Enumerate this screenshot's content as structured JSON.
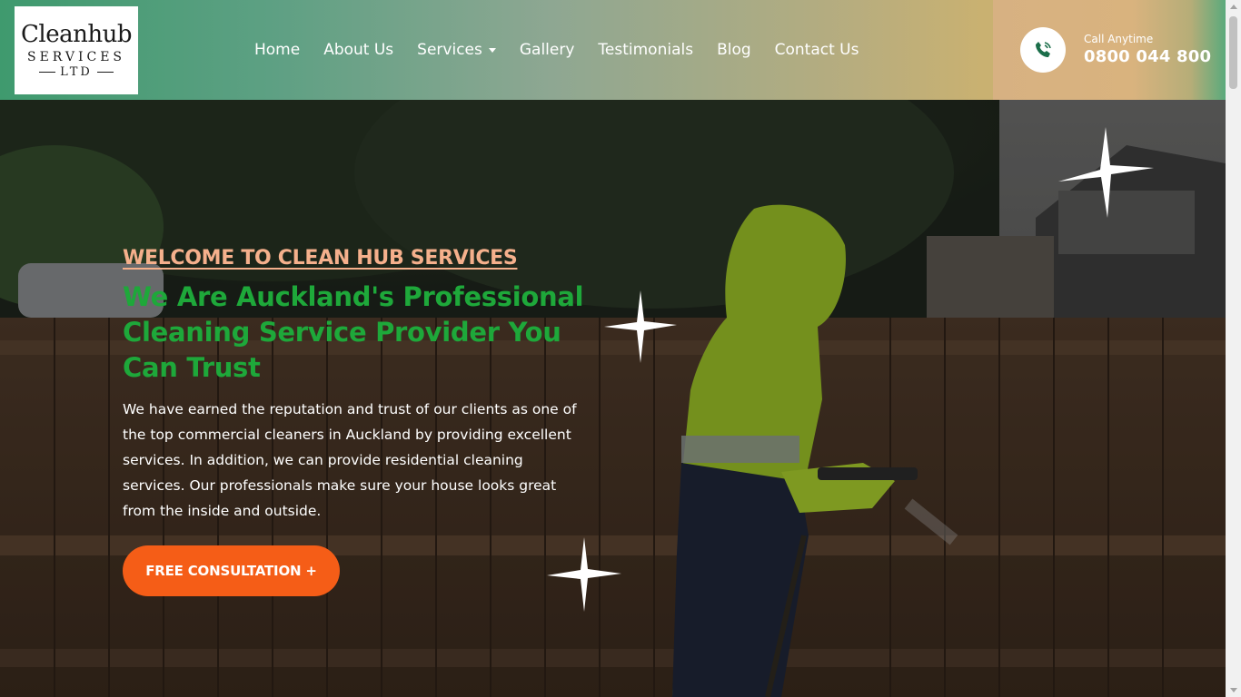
{
  "logo": {
    "line1": "Cleanhub",
    "line2": "SERVICES",
    "line3": "LTD"
  },
  "nav": {
    "items": [
      {
        "label": "Home"
      },
      {
        "label": "About Us"
      },
      {
        "label": "Services"
      },
      {
        "label": "Gallery"
      },
      {
        "label": "Testimonials"
      },
      {
        "label": "Blog"
      },
      {
        "label": "Contact Us"
      }
    ]
  },
  "call": {
    "label": "Call Anytime",
    "number": "0800 044 800",
    "icon": "phone-icon"
  },
  "hero": {
    "welcome": "WELCOME TO CLEAN HUB SERVICES",
    "headline": "We Are Auckland's Professional Cleaning Service Provider You Can Trust",
    "description": "We have earned the reputation and trust of our clients as one of the top commercial cleaners in Auckland by providing excellent services. In addition, we can provide residential cleaning services. Our professionals make sure your house looks great from the inside and outside.",
    "cta_label": "FREE CONSULTATION +",
    "sparkle_icon": "sparkle-icon"
  },
  "colors": {
    "accent_orange": "#f55d17",
    "headline_green": "#1ea83a",
    "welcome_peach": "#f5b08c",
    "header_green": "#3f9a6e"
  }
}
